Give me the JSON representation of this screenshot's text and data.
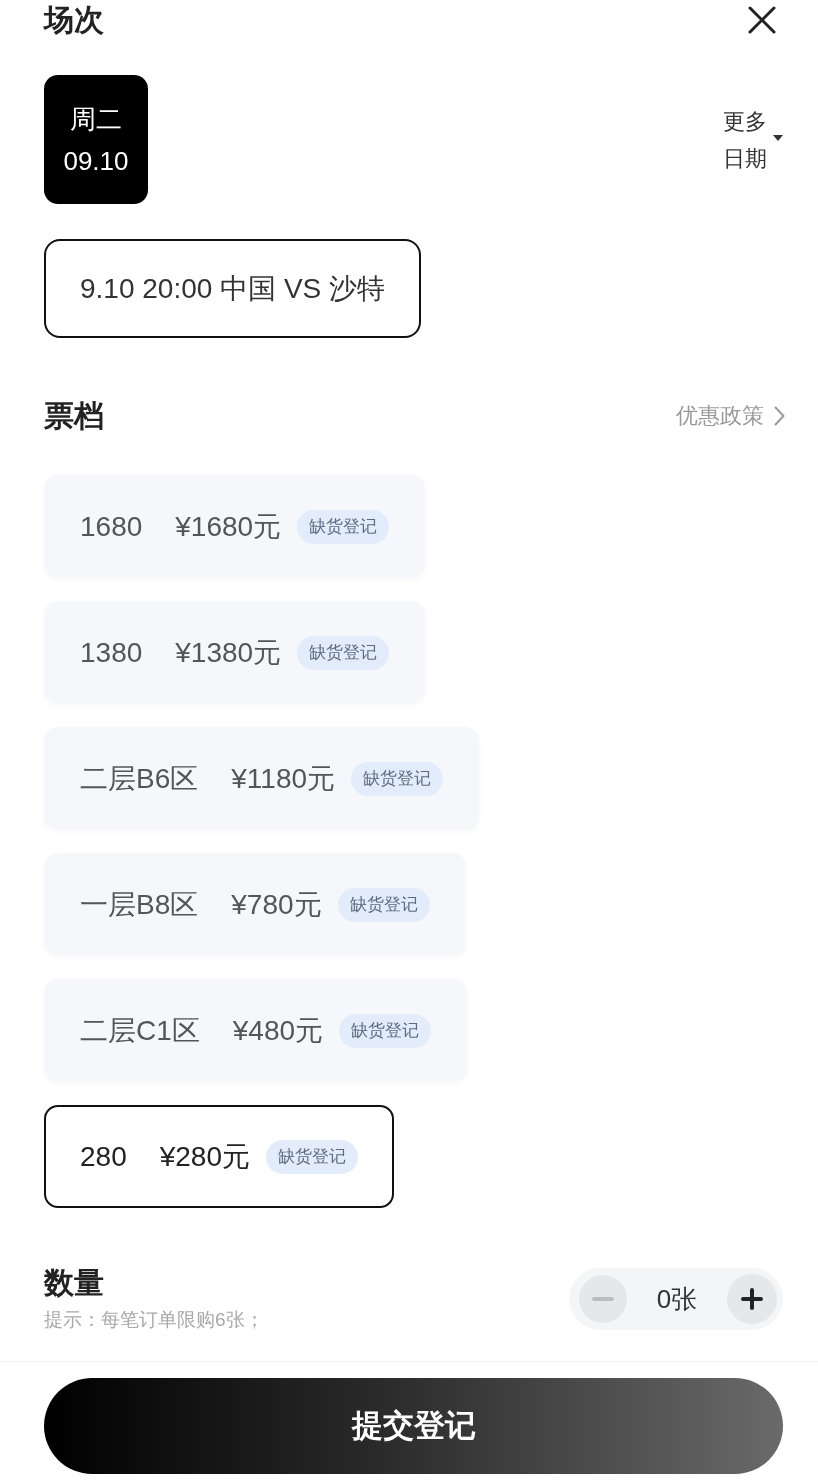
{
  "header": {
    "title": "场次"
  },
  "dates": [
    {
      "weekday": "周二",
      "date": "09.10",
      "selected": true
    }
  ],
  "more_dates": {
    "label": "更多日期"
  },
  "sessions": [
    {
      "label": "9.10 20:00 中国 VS 沙特",
      "selected": true
    }
  ],
  "tiers_section": {
    "title": "票档",
    "link": "优惠政策"
  },
  "tiers": [
    {
      "name": "1680",
      "price": "¥1680元",
      "badge": "缺货登记",
      "selected": false
    },
    {
      "name": "1380",
      "price": "¥1380元",
      "badge": "缺货登记",
      "selected": false
    },
    {
      "name": "二层B6区",
      "price": "¥1180元",
      "badge": "缺货登记",
      "selected": false
    },
    {
      "name": "一层B8区",
      "price": "¥780元",
      "badge": "缺货登记",
      "selected": false
    },
    {
      "name": "二层C1区",
      "price": "¥480元",
      "badge": "缺货登记",
      "selected": false
    },
    {
      "name": "280",
      "price": "¥280元",
      "badge": "缺货登记",
      "selected": true
    }
  ],
  "quantity": {
    "title": "数量",
    "hint": "提示：每笔订单限购6张；",
    "value": "0张",
    "decrement_disabled": true,
    "increment_disabled": false
  },
  "submit": {
    "label": "提交登记"
  }
}
